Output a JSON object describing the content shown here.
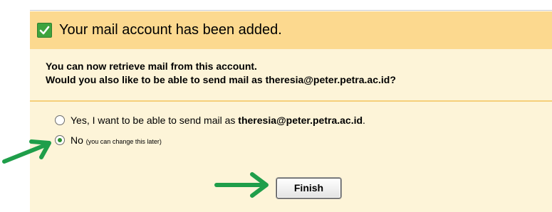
{
  "dialog": {
    "title": "Your mail account has been added.",
    "info_line1": "You can now retrieve mail from this account.",
    "info_line2": "Would you also like to be able to send mail as theresia@peter.petra.ac.id?"
  },
  "options": {
    "yes_text": "Yes, I want to be able to send mail as ",
    "yes_email": "theresia@peter.petra.ac.id",
    "yes_suffix": ".",
    "no_label": "No",
    "no_note": "(you can change this later)",
    "selected": "no"
  },
  "finish_button": {
    "label": "Finish"
  },
  "colors": {
    "header_bg": "#fcd98f",
    "panel_bg": "#fdf4d8",
    "check_green": "#3ea33e",
    "arrow_green": "#1f9e4a"
  },
  "icons": {
    "check": "check-icon",
    "arrows": "arrow-right-icon"
  }
}
